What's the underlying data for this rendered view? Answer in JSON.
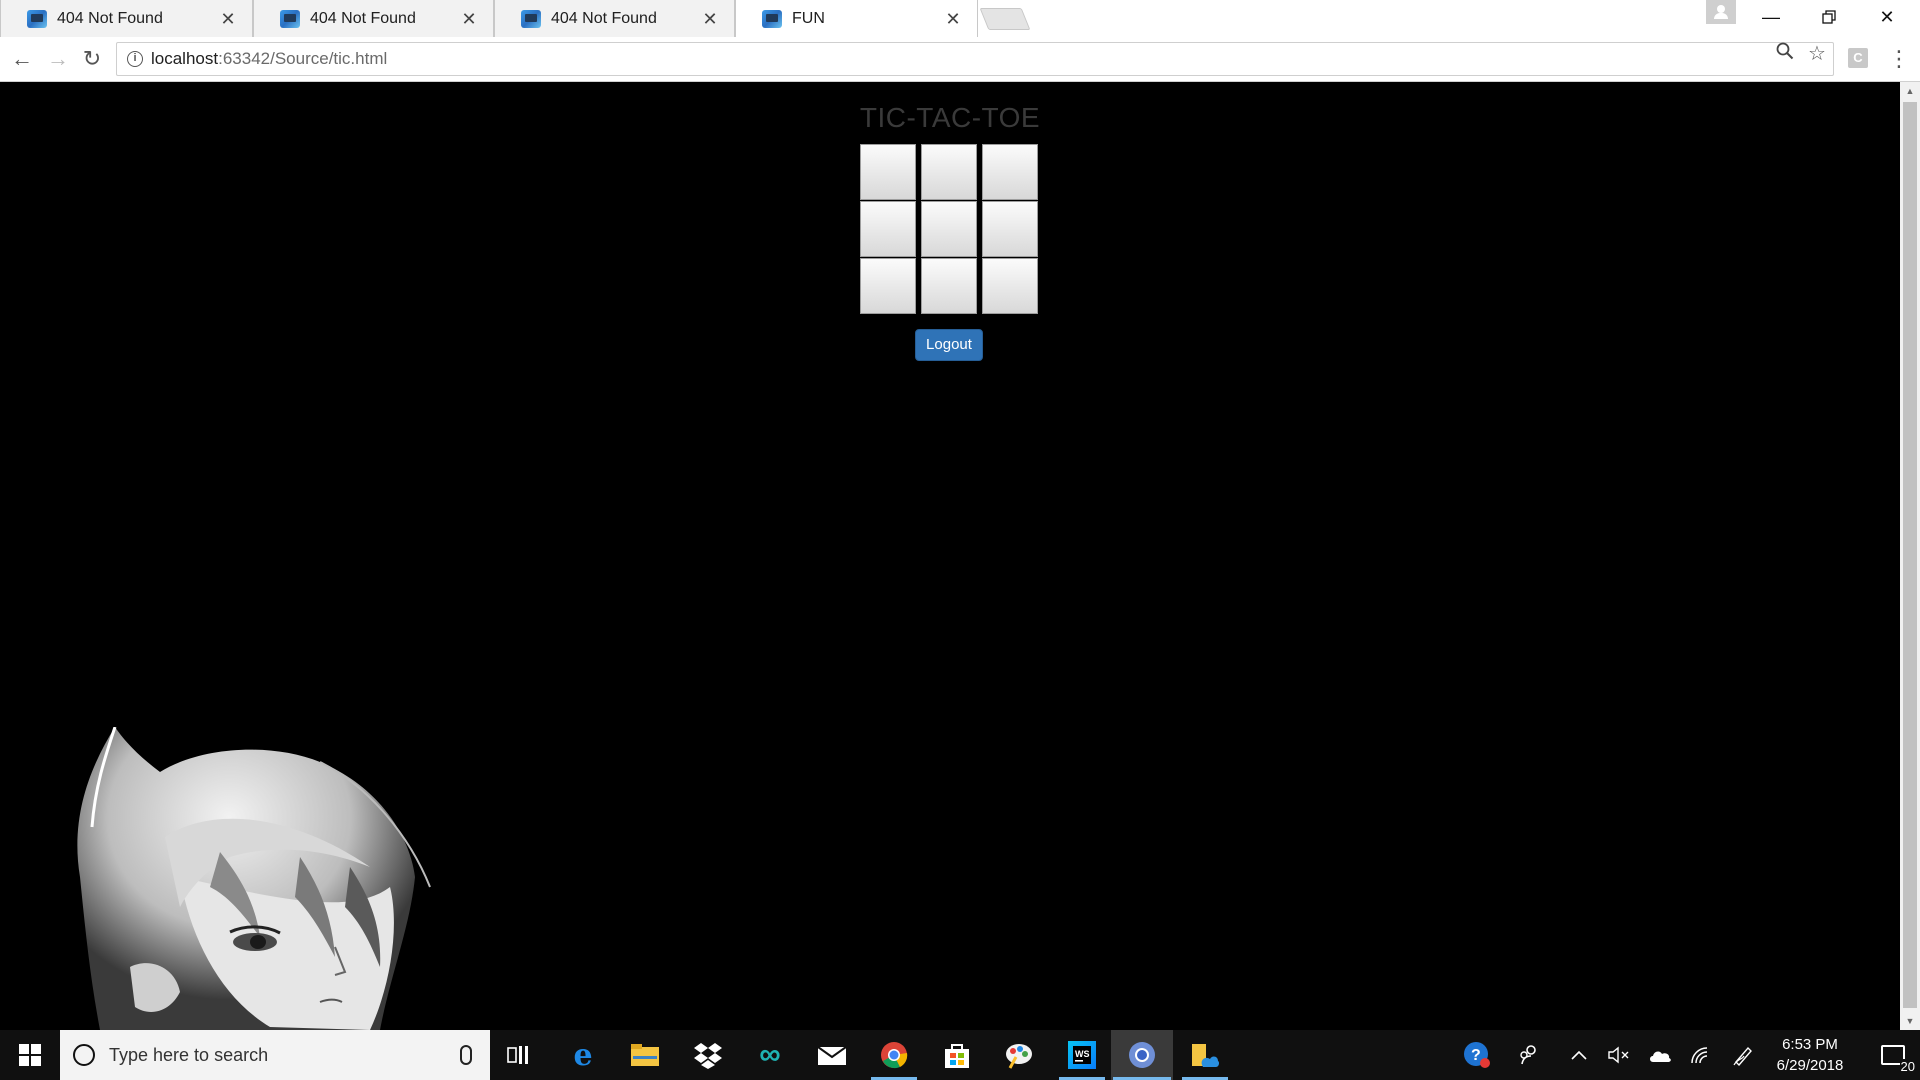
{
  "browser": {
    "tabs": [
      {
        "title": "404 Not Found",
        "active": false
      },
      {
        "title": "404 Not Found",
        "active": false
      },
      {
        "title": "404 Not Found",
        "active": false
      },
      {
        "title": "FUN",
        "active": true
      }
    ],
    "address": {
      "host": "localhost",
      "rest": ":63342/Source/tic.html"
    }
  },
  "page": {
    "title": "TIC-TAC-TOE",
    "board": [
      "",
      "",
      "",
      "",
      "",
      "",
      "",
      "",
      ""
    ],
    "logout_label": "Logout"
  },
  "taskbar": {
    "search_placeholder": "Type here to search",
    "time": "6:53 PM",
    "date": "6/29/2018",
    "notification_count": "20"
  },
  "icons": {
    "tab_favicon": "webstorm-icon",
    "start": "windows-logo-icon",
    "apps": [
      "task-view-icon",
      "edge-icon",
      "file-explorer-icon",
      "dropbox-icon",
      "infinity-app-icon",
      "mail-icon",
      "chrome-icon",
      "store-icon",
      "paint-icon",
      "webstorm-icon",
      "chrome-canary-icon",
      "folder-onedrive-icon"
    ]
  },
  "colors": {
    "page_background": "#000000",
    "logout_button": "#2f73b7",
    "title_text": "#3a3a3a",
    "taskbar": "#101010"
  }
}
